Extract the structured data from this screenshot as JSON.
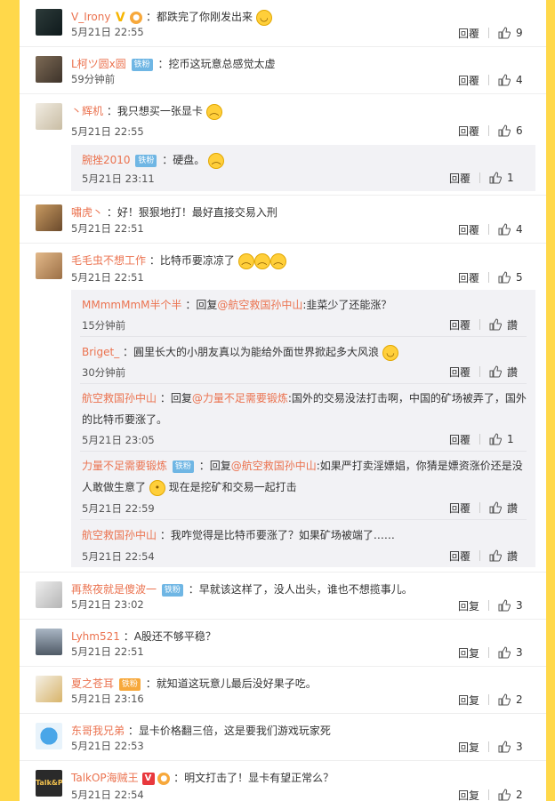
{
  "labels": {
    "reply": "回覆",
    "reply_alt": "回复",
    "like_fallback": "讚"
  },
  "comments": [
    {
      "user": "V_Irony",
      "text": "：都跌完了你刚发出来",
      "time": "5月21日 22:55",
      "likes": "9",
      "reply": "回覆"
    },
    {
      "user": "L柯ツ圆x圆",
      "badge": "铁粉",
      "text": "：挖币这玩意总感觉太虚",
      "time": "59分钟前",
      "likes": "4",
      "reply": "回覆"
    },
    {
      "user": "丶辉机",
      "text": "：我只想买一张显卡",
      "time": "5月21日 22:55",
      "likes": "6",
      "reply": "回覆"
    },
    {
      "user": "腕挫2010",
      "badge": "铁粉",
      "text": "：硬盘。",
      "time": "5月21日 23:11",
      "likes": "1",
      "reply": "回覆"
    },
    {
      "user": "嘯虎丶",
      "text": "：好！狠狠地打！最好直接交易入刑",
      "time": "5月21日 22:51",
      "likes": "4",
      "reply": "回覆"
    },
    {
      "user": "毛毛虫不想工作",
      "text": "：比特币要凉凉了",
      "time": "5月21日 22:51",
      "likes": "5",
      "reply": "回覆"
    },
    {
      "user": "MMmmMmM半个半",
      "text": "：回复",
      "mention": "@航空救国孙中山",
      "text2": ":韭菜少了还能涨？",
      "time": "15分钟前",
      "likes": "讚",
      "reply": "回覆"
    },
    {
      "user": "Briget_",
      "text": "：圓里长大的小朋友真以为能给外面世界掀起多大风浪",
      "time": "30分钟前",
      "likes": "讚",
      "reply": "回覆"
    },
    {
      "user": "航空救国孙中山",
      "text": "：回复",
      "mention": "@力量不足需要锻炼",
      "text2": ":国外的交易没法打击啊，中国的矿场被弄了，国外的比特币要涨了。",
      "time": "5月21日 23:05",
      "likes": "1",
      "reply": "回覆"
    },
    {
      "user": "力量不足需要锻炼",
      "badge": "铁粉",
      "text": "：回复",
      "mention": "@航空救国孙中山",
      "text2": ":如果严打卖淫嫖娼，你猜是嫖资涨价还是没人敢做生意了",
      "text3": " 现在是挖矿和交易一起打击",
      "time": "5月21日 22:59",
      "likes": "讚",
      "reply": "回覆"
    },
    {
      "user": "航空救国孙中山",
      "text": "：我咋觉得是比特币要涨了？如果矿场被端了……",
      "time": "5月21日 22:54",
      "likes": "讚",
      "reply": "回覆"
    },
    {
      "user": "再熬夜就是傻波一",
      "badge": "铁粉",
      "text": "：早就该这样了，没人出头，谁也不想揽事儿。",
      "time": "5月21日 23:02",
      "likes": "3",
      "reply": "回复"
    },
    {
      "user": "Lyhm521",
      "text": "：A股还不够平稳？",
      "time": "5月21日 22:51",
      "likes": "3",
      "reply": "回复"
    },
    {
      "user": "夏之苍耳",
      "badge": "铁粉",
      "text": "：就知道这玩意儿最后没好果子吃。",
      "time": "5月21日 23:16",
      "likes": "2",
      "reply": "回复"
    },
    {
      "user": "东哥我兄弟",
      "text": "：显卡价格翻三倍，这是要我们游戏玩家死",
      "time": "5月21日 22:53",
      "likes": "3",
      "reply": "回复"
    },
    {
      "user": "TalkOP海贼王",
      "text": "：明文打击了！显卡有望正常么？",
      "time": "5月21日 22:54",
      "likes": "2",
      "reply": "回复"
    }
  ],
  "avatar_text": {
    "talkop": "Talk&P"
  }
}
